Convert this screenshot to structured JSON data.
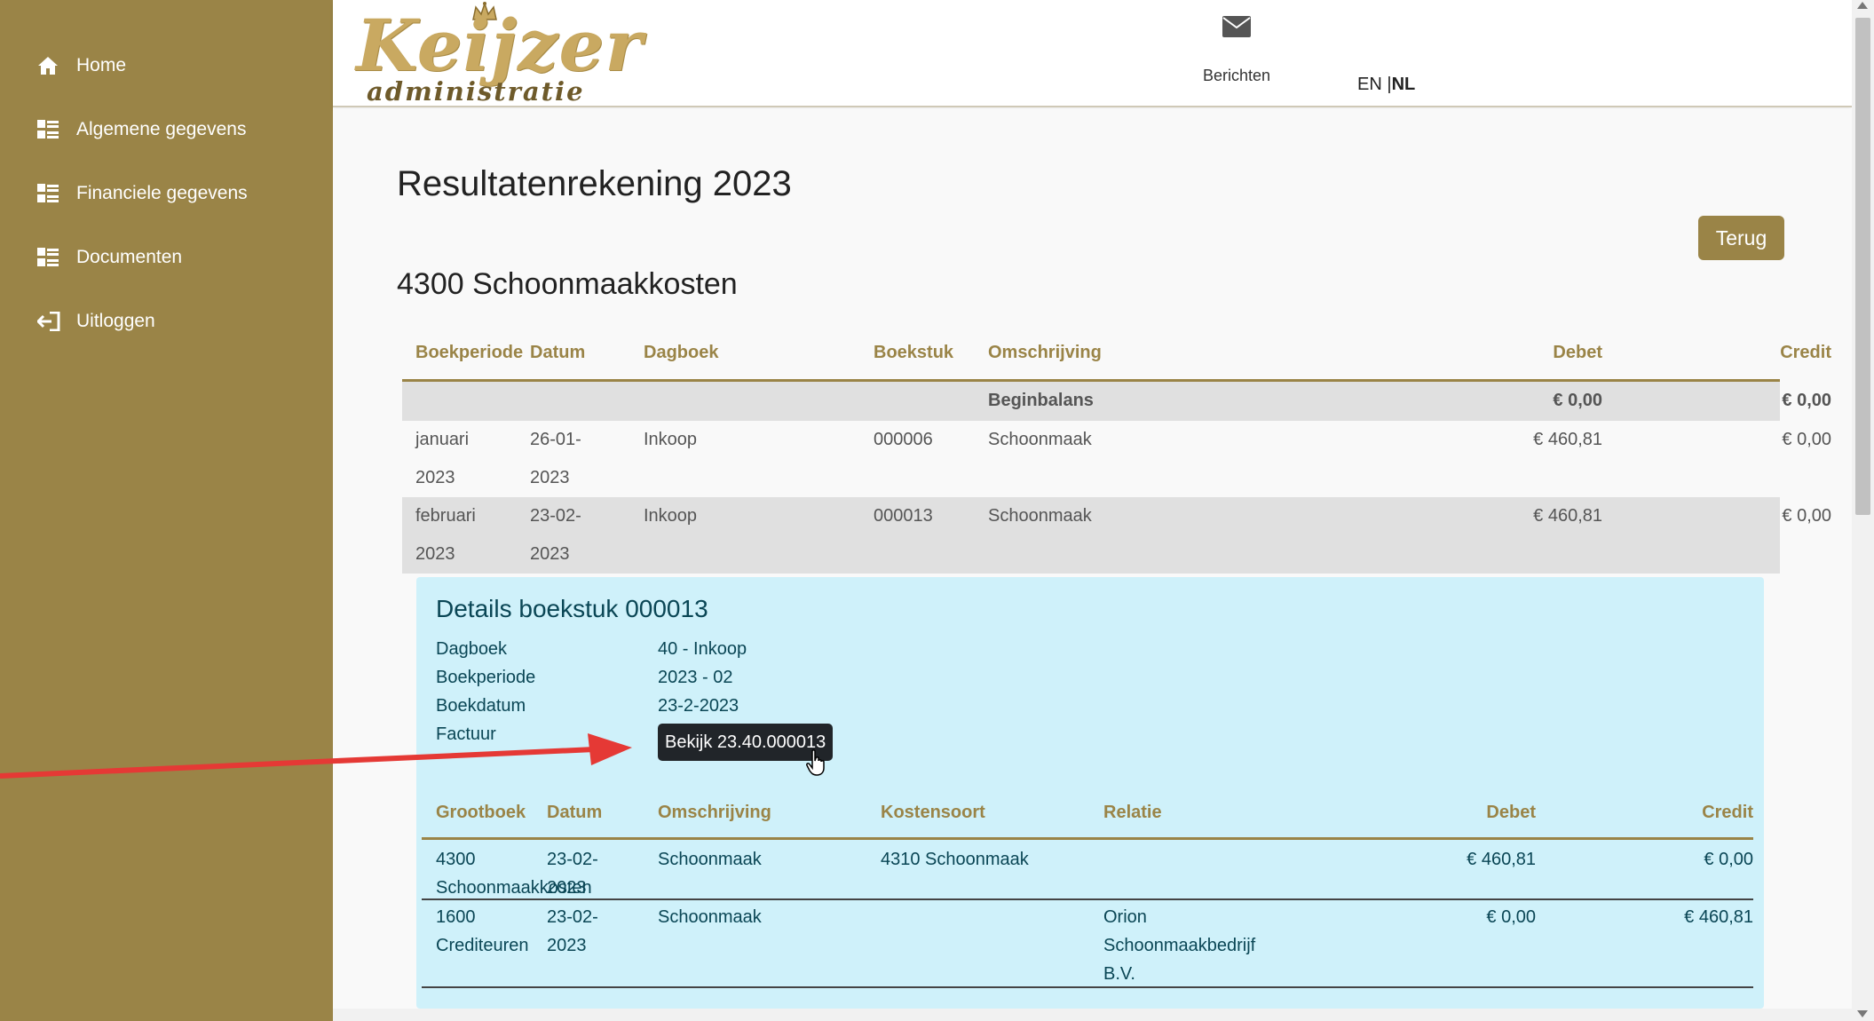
{
  "sidebar": {
    "items": [
      {
        "label": "Home",
        "icon": "home-icon"
      },
      {
        "label": "Algemene gegevens",
        "icon": "list-icon"
      },
      {
        "label": "Financiele gegevens",
        "icon": "list-icon"
      },
      {
        "label": "Documenten",
        "icon": "list-icon"
      },
      {
        "label": "Uitloggen",
        "icon": "logout-icon"
      }
    ]
  },
  "header": {
    "logo_word": "Keijzer",
    "logo_sub": "administratie",
    "messages_label": "Berichten",
    "lang_en": "EN",
    "lang_sep": "|",
    "lang_nl": "NL"
  },
  "page": {
    "title": "Resultatenrekening 2023",
    "back_label": "Terug",
    "section_title": "4300 Schoonmaakkosten"
  },
  "ledger": {
    "headers": [
      "Boekperiode",
      "Datum",
      "Dagboek",
      "Boekstuk",
      "Omschrijving",
      "Debet",
      "Credit"
    ],
    "begin": {
      "label": "Beginbalans",
      "debet": "€ 0,00",
      "credit": "€ 0,00"
    },
    "rows": [
      {
        "period1": "januari",
        "period2": "2023",
        "date1": "26-01-",
        "date2": "2023",
        "journal": "Inkoop",
        "doc": "000006",
        "desc": "Schoonmaak",
        "debet": "€ 460,81",
        "credit": "€ 0,00"
      },
      {
        "period1": "februari",
        "period2": "2023",
        "date1": "23-02-",
        "date2": "2023",
        "journal": "Inkoop",
        "doc": "000013",
        "desc": "Schoonmaak",
        "debet": "€ 460,81",
        "credit": "€ 0,00"
      }
    ]
  },
  "details": {
    "title": "Details boekstuk 000013",
    "fields": [
      {
        "key": "Dagboek",
        "value": "40 - Inkoop"
      },
      {
        "key": "Boekperiode",
        "value": "2023 - 02"
      },
      {
        "key": "Boekdatum",
        "value": "23-2-2023"
      },
      {
        "key": "Factuur",
        "value": ""
      }
    ],
    "view_label": "Bekijk 23.40.000013",
    "headers": [
      "Grootboek",
      "Datum",
      "Omschrijving",
      "Kostensoort",
      "Relatie",
      "Debet",
      "Credit"
    ],
    "rows": [
      {
        "ledger1": "4300",
        "ledger2": "Schoonmaakkosten",
        "date1": "23-02-",
        "date2": "2023",
        "desc": "Schoonmaak",
        "costtype": "4310 Schoonmaak",
        "rel1": "",
        "rel2": "",
        "rel3": "",
        "debet": "€ 460,81",
        "credit": "€ 0,00"
      },
      {
        "ledger1": "1600",
        "ledger2": "Crediteuren",
        "date1": "23-02-",
        "date2": "2023",
        "desc": "Schoonmaak",
        "costtype": "",
        "rel1": "Orion",
        "rel2": "Schoonmaakbedrijf",
        "rel3": "B.V.",
        "debet": "€ 0,00",
        "credit": "€ 460,81"
      }
    ]
  },
  "colors": {
    "accent": "#9a8447",
    "details_bg": "#cff1fa",
    "annotation_arrow": "#e53935"
  }
}
